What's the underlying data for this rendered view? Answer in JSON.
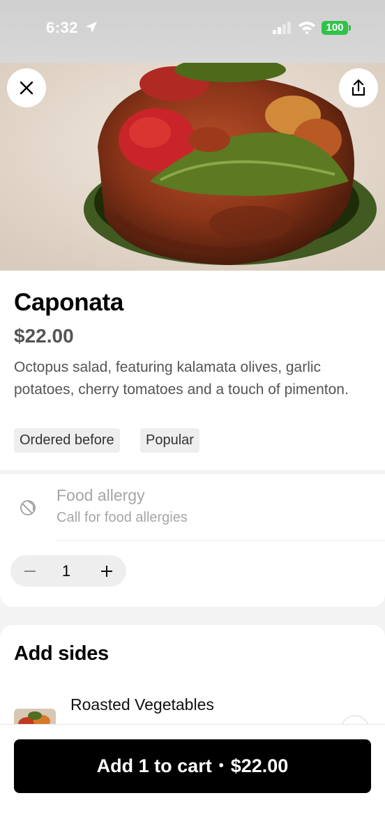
{
  "status_bar": {
    "time": "6:32",
    "battery": "100"
  },
  "item": {
    "title": "Caponata",
    "price": "$22.00",
    "description": "Octopus salad, featuring kalamata olives, garlic potatoes, cherry tomatoes and a touch of pimenton.",
    "tags": [
      "Ordered before",
      "Popular"
    ]
  },
  "allergy": {
    "title": "Food allergy",
    "subtitle": "Call for food allergies",
    "icon": "allergy-icon"
  },
  "quantity": {
    "value": "1"
  },
  "sides": {
    "title": "Add sides",
    "items": [
      {
        "name": "Roasted Vegetables"
      }
    ]
  },
  "cart": {
    "label": "Add 1 to cart",
    "separator": "•",
    "price": "$22.00"
  },
  "icons": {
    "close": "close-icon",
    "share": "share-icon"
  },
  "colors": {
    "primary_button": "#000000",
    "battery": "#31c24a",
    "muted_text": "#a6a6a6"
  }
}
